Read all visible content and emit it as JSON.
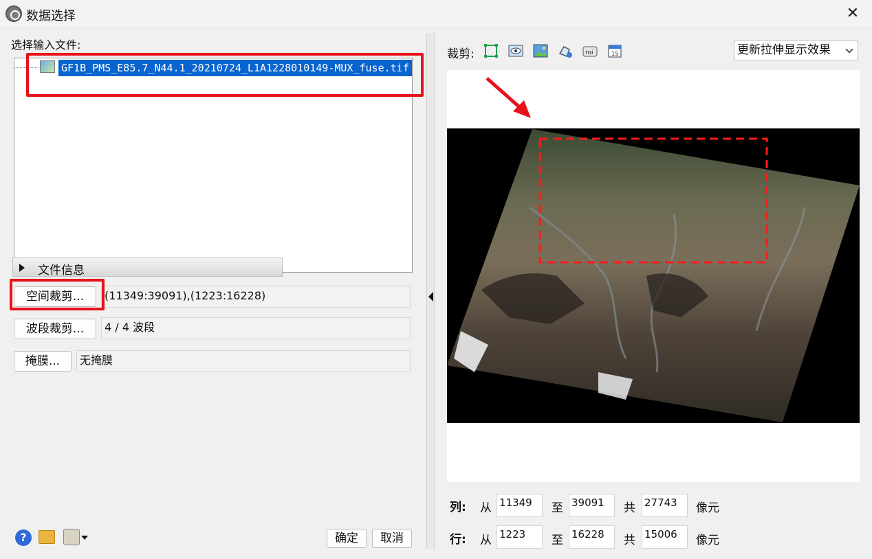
{
  "window": {
    "title": "数据选择",
    "close_label": "✕"
  },
  "left": {
    "input_files_label": "选择输入文件:",
    "file_name": "GF1B_PMS_E85.7_N44.1_20210724_L1A1228010149-MUX_fuse.tif",
    "file_info_label": "文件信息",
    "spatial_subset_button": "空间裁剪...",
    "spatial_subset_value": "(11349:39091),(1223:16228)",
    "spectral_subset_button": "波段裁剪...",
    "spectral_subset_value": "4 / 4 波段",
    "mask_button": "掩膜...",
    "mask_value": "无掩膜",
    "help_icon_glyph": "?",
    "ok_button": "确定",
    "cancel_button": "取消"
  },
  "right": {
    "crop_label": "裁剪:",
    "tool_icons": [
      "select-region-icon",
      "eye-view-icon",
      "image-view-icon",
      "vector-edit-icon",
      "roi-icon",
      "calendar-icon"
    ],
    "stretch_select": "更新拉伸显示效果",
    "rows": {
      "col_label": "列:",
      "row_label": "行:",
      "from_label": "从",
      "to_label": "至",
      "total_label": "共",
      "unit_label": "像元"
    },
    "columns": {
      "from": "11349",
      "to": "39091",
      "total": "27743"
    },
    "lines": {
      "from": "1223",
      "to": "16228",
      "total": "15006"
    }
  },
  "colors": {
    "highlight_red": "#e8121b",
    "selection_blue": "#0a64d0",
    "dashed_subset": "#ff1a1a"
  }
}
